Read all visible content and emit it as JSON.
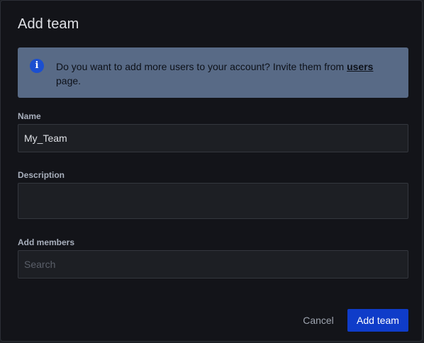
{
  "dialog": {
    "title": "Add team"
  },
  "info": {
    "icon": "info-icon",
    "icon_glyph": "i",
    "text_before": "Do you want to add more users to your account? Invite them from ",
    "link_text": "users",
    "text_after": " page."
  },
  "form": {
    "name_label": "Name",
    "name_value": "My_Team",
    "description_label": "Description",
    "description_value": "",
    "members_label": "Add members",
    "members_placeholder": "Search"
  },
  "actions": {
    "cancel_label": "Cancel",
    "submit_label": "Add team"
  },
  "colors": {
    "background": "#131419",
    "info_bg": "#586a86",
    "primary": "#0f3cc9"
  }
}
